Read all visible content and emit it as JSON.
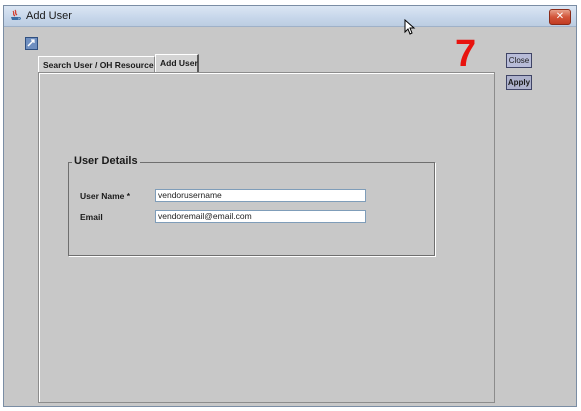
{
  "window": {
    "title": "Add User",
    "close_glyph": "✕",
    "app_icon": "java-app-icon"
  },
  "toolbar": {
    "icon": "refresh-icon"
  },
  "tabs": [
    {
      "label": "Search User / OH Resource",
      "active": false
    },
    {
      "label": "Add User",
      "active": true
    }
  ],
  "buttons": {
    "close_label": "Close",
    "apply_label": "Apply"
  },
  "user_details": {
    "legend": "User Details",
    "username_label": "User Name *",
    "username_value": "vendorusername",
    "email_label": "Email",
    "email_value": "vendoremail@email.com"
  },
  "annotation": {
    "step_number": "7",
    "color": "#e8130e"
  }
}
